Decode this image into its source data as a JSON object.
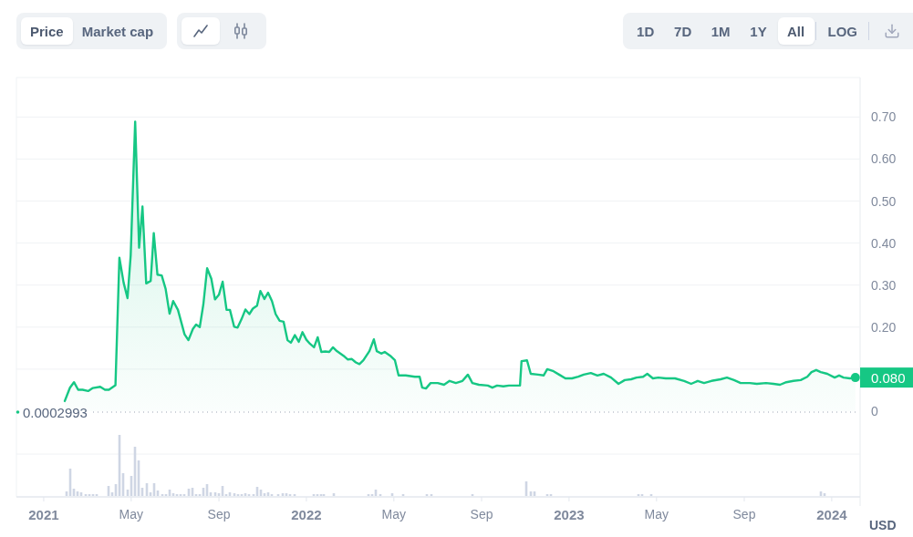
{
  "toolbar": {
    "metric_tabs": [
      {
        "label": "Price",
        "selected": true
      },
      {
        "label": "Market cap",
        "selected": false
      }
    ],
    "chart_types": [
      {
        "kind": "line",
        "selected": true
      },
      {
        "kind": "candlestick",
        "selected": false
      }
    ],
    "ranges": [
      {
        "label": "1D",
        "selected": false
      },
      {
        "label": "7D",
        "selected": false
      },
      {
        "label": "1M",
        "selected": false
      },
      {
        "label": "1Y",
        "selected": false
      },
      {
        "label": "All",
        "selected": true
      }
    ],
    "log_label": "LOG"
  },
  "chart": {
    "chart_data": {
      "type": "area",
      "ylabel": "USD",
      "grid": true,
      "x": [
        2021.08,
        2021.1,
        2021.115,
        2021.131,
        2021.148,
        2021.169,
        2021.187,
        2021.215,
        2021.233,
        2021.248,
        2021.273,
        2021.288,
        2021.304,
        2021.319,
        2021.331,
        2021.348,
        2021.363,
        2021.376,
        2021.39,
        2021.407,
        2021.419,
        2021.433,
        2021.449,
        2021.464,
        2021.479,
        2021.493,
        2021.511,
        2021.536,
        2021.551,
        2021.568,
        2021.58,
        2021.594,
        2021.608,
        2021.622,
        2021.638,
        2021.652,
        2021.667,
        2021.681,
        2021.696,
        2021.709,
        2021.725,
        2021.738,
        2021.753,
        2021.768,
        2021.783,
        2021.796,
        2021.812,
        2021.825,
        2021.84,
        2021.854,
        2021.869,
        2021.883,
        2021.898,
        2021.913,
        2021.928,
        2021.941,
        2021.956,
        2021.971,
        2021.985,
        2022.0,
        2022.014,
        2022.029,
        2022.043,
        2022.057,
        2022.072,
        2022.087,
        2022.101,
        2022.116,
        2022.129,
        2022.145,
        2022.158,
        2022.173,
        2022.188,
        2022.202,
        2022.217,
        2022.24,
        2022.257,
        2022.268,
        2022.285,
        2022.298,
        2022.319,
        2022.337,
        2022.351,
        2022.378,
        2022.413,
        2022.431,
        2022.441,
        2022.455,
        2022.473,
        2022.5,
        2022.524,
        2022.545,
        2022.569,
        2022.594,
        2022.615,
        2022.632,
        2022.657,
        2022.691,
        2022.708,
        2022.726,
        2022.75,
        2022.771,
        2022.795,
        2022.813,
        2022.819,
        2022.84,
        2022.854,
        2022.882,
        2022.903,
        2022.917,
        2022.941,
        2022.962,
        2022.986,
        2023.011,
        2023.035,
        2023.056,
        2023.083,
        2023.108,
        2023.132,
        2023.16,
        2023.188,
        2023.212,
        2023.236,
        2023.257,
        2023.282,
        2023.298,
        2023.319,
        2023.34,
        2023.368,
        2023.403,
        2023.438,
        2023.465,
        2023.49,
        2023.514,
        2023.542,
        2023.577,
        2023.601,
        2023.628,
        2023.653,
        2023.688,
        2023.715,
        2023.75,
        2023.778,
        2023.803,
        2023.827,
        2023.854,
        2023.882,
        2023.907,
        2023.923,
        2023.941,
        2023.958,
        2023.983,
        2024.011,
        2024.028,
        2024.045,
        2024.069,
        2024.09
      ],
      "series": [
        {
          "color": "#16c784",
          "values": [
            0.024,
            0.056,
            0.069,
            0.051,
            0.051,
            0.048,
            0.055,
            0.058,
            0.051,
            0.051,
            0.062,
            0.365,
            0.306,
            0.269,
            0.371,
            0.689,
            0.389,
            0.487,
            0.304,
            0.31,
            0.424,
            0.325,
            0.323,
            0.291,
            0.232,
            0.262,
            0.241,
            0.183,
            0.169,
            0.196,
            0.206,
            0.2,
            0.255,
            0.34,
            0.315,
            0.266,
            0.277,
            0.308,
            0.241,
            0.241,
            0.201,
            0.199,
            0.219,
            0.242,
            0.231,
            0.244,
            0.251,
            0.286,
            0.267,
            0.282,
            0.262,
            0.231,
            0.215,
            0.213,
            0.169,
            0.163,
            0.181,
            0.165,
            0.188,
            0.17,
            0.16,
            0.152,
            0.176,
            0.141,
            0.142,
            0.141,
            0.152,
            0.143,
            0.137,
            0.13,
            0.123,
            0.124,
            0.116,
            0.112,
            0.121,
            0.143,
            0.171,
            0.143,
            0.137,
            0.141,
            0.132,
            0.121,
            0.085,
            0.085,
            0.082,
            0.082,
            0.056,
            0.054,
            0.067,
            0.067,
            0.063,
            0.072,
            0.067,
            0.072,
            0.087,
            0.067,
            0.063,
            0.061,
            0.056,
            0.061,
            0.059,
            0.061,
            0.061,
            0.061,
            0.119,
            0.121,
            0.089,
            0.087,
            0.085,
            0.1,
            0.095,
            0.087,
            0.078,
            0.078,
            0.082,
            0.087,
            0.091,
            0.085,
            0.089,
            0.08,
            0.065,
            0.074,
            0.076,
            0.08,
            0.082,
            0.089,
            0.078,
            0.08,
            0.078,
            0.078,
            0.072,
            0.065,
            0.072,
            0.067,
            0.072,
            0.076,
            0.08,
            0.074,
            0.067,
            0.067,
            0.065,
            0.067,
            0.065,
            0.063,
            0.069,
            0.072,
            0.074,
            0.082,
            0.093,
            0.098,
            0.093,
            0.089,
            0.08,
            0.085,
            0.08,
            0.078,
            0.08
          ]
        }
      ],
      "xlim": [
        2020.896,
        2024.108
      ],
      "ylim": [
        0,
        0.794
      ],
      "xticks": [
        {
          "value": 2021,
          "label": "2021"
        },
        {
          "value": 2021.333,
          "label": "May"
        },
        {
          "value": 2021.667,
          "label": "Sep"
        },
        {
          "value": 2022,
          "label": "2022"
        },
        {
          "value": 2022.333,
          "label": "May"
        },
        {
          "value": 2022.667,
          "label": "Sep"
        },
        {
          "value": 2023,
          "label": "2023"
        },
        {
          "value": 2023.333,
          "label": "May"
        },
        {
          "value": 2023.667,
          "label": "Sep"
        },
        {
          "value": 2024,
          "label": "2024"
        }
      ],
      "yticks": [
        {
          "value": 0,
          "label": "0"
        },
        {
          "value": 0.2,
          "label": "0.20"
        },
        {
          "value": 0.3,
          "label": "0.30"
        },
        {
          "value": 0.4,
          "label": "0.40"
        },
        {
          "value": 0.5,
          "label": "0.50"
        },
        {
          "value": 0.6,
          "label": "0.60"
        },
        {
          "value": 0.7,
          "label": "0.70"
        }
      ]
    },
    "start_price_label": "0.0002993",
    "last_price_label": "0.080"
  }
}
